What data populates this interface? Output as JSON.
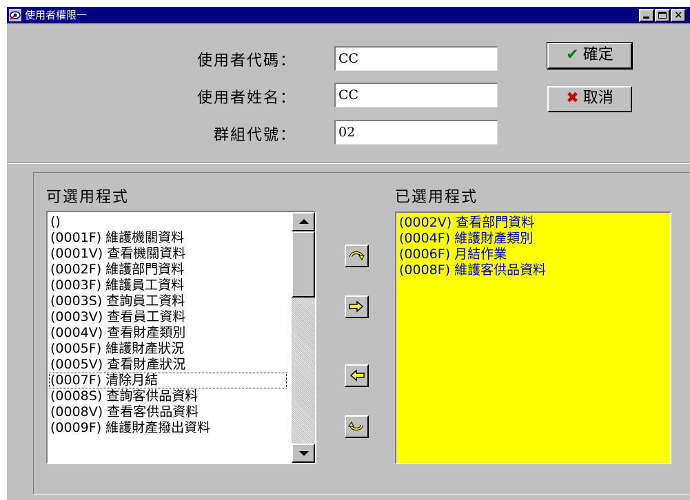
{
  "window": {
    "title": "使用者權限一",
    "icon": "app-icon",
    "controls": [
      "minimize",
      "maximize",
      "close"
    ]
  },
  "form": {
    "user_code": {
      "label": "使用者代碼：",
      "value": "CC"
    },
    "user_name": {
      "label": "使用者姓名：",
      "value": "CC"
    },
    "group_code": {
      "label": "群組代號：",
      "value": "02"
    }
  },
  "buttons": {
    "ok": {
      "label": "確定",
      "icon": "check-icon",
      "color": "#008000"
    },
    "cancel": {
      "label": "取消",
      "icon": "x-icon",
      "color": "#cc0000"
    }
  },
  "available": {
    "label": "可選用程式",
    "items": [
      "()",
      "(0001F) 維護機關資料",
      "(0001V) 查看機關資料",
      "(0002F) 維護部門資料",
      "(0003F) 維護員工資料",
      "(0003S) 查詢員工資料",
      "(0003V) 查看員工資料",
      "(0004V) 查看財產類別",
      "(0005F) 維護財產狀況",
      "(0005V) 查看財產狀況",
      "(0007F) 清除月結",
      "(0008S) 查詢客供品資料",
      "(0008V) 查看客供品資料",
      "(0009F) 維護財產撥出資料"
    ],
    "focused_index": 10
  },
  "selected": {
    "label": "已選用程式",
    "items": [
      "(0002V) 查看部門資料",
      "(0004F) 維護財產類別",
      "(0006F) 月結作業",
      "(0008F) 維護客供品資料"
    ],
    "background": "#ffff00",
    "text_color": "#0000cc"
  },
  "move_buttons": [
    "add-all-icon",
    "add-one-icon",
    "remove-one-icon",
    "remove-all-icon"
  ],
  "colors": {
    "titlebar": "#000080",
    "face": "#c0c0c0",
    "arrow_fill": "#ffff00"
  }
}
